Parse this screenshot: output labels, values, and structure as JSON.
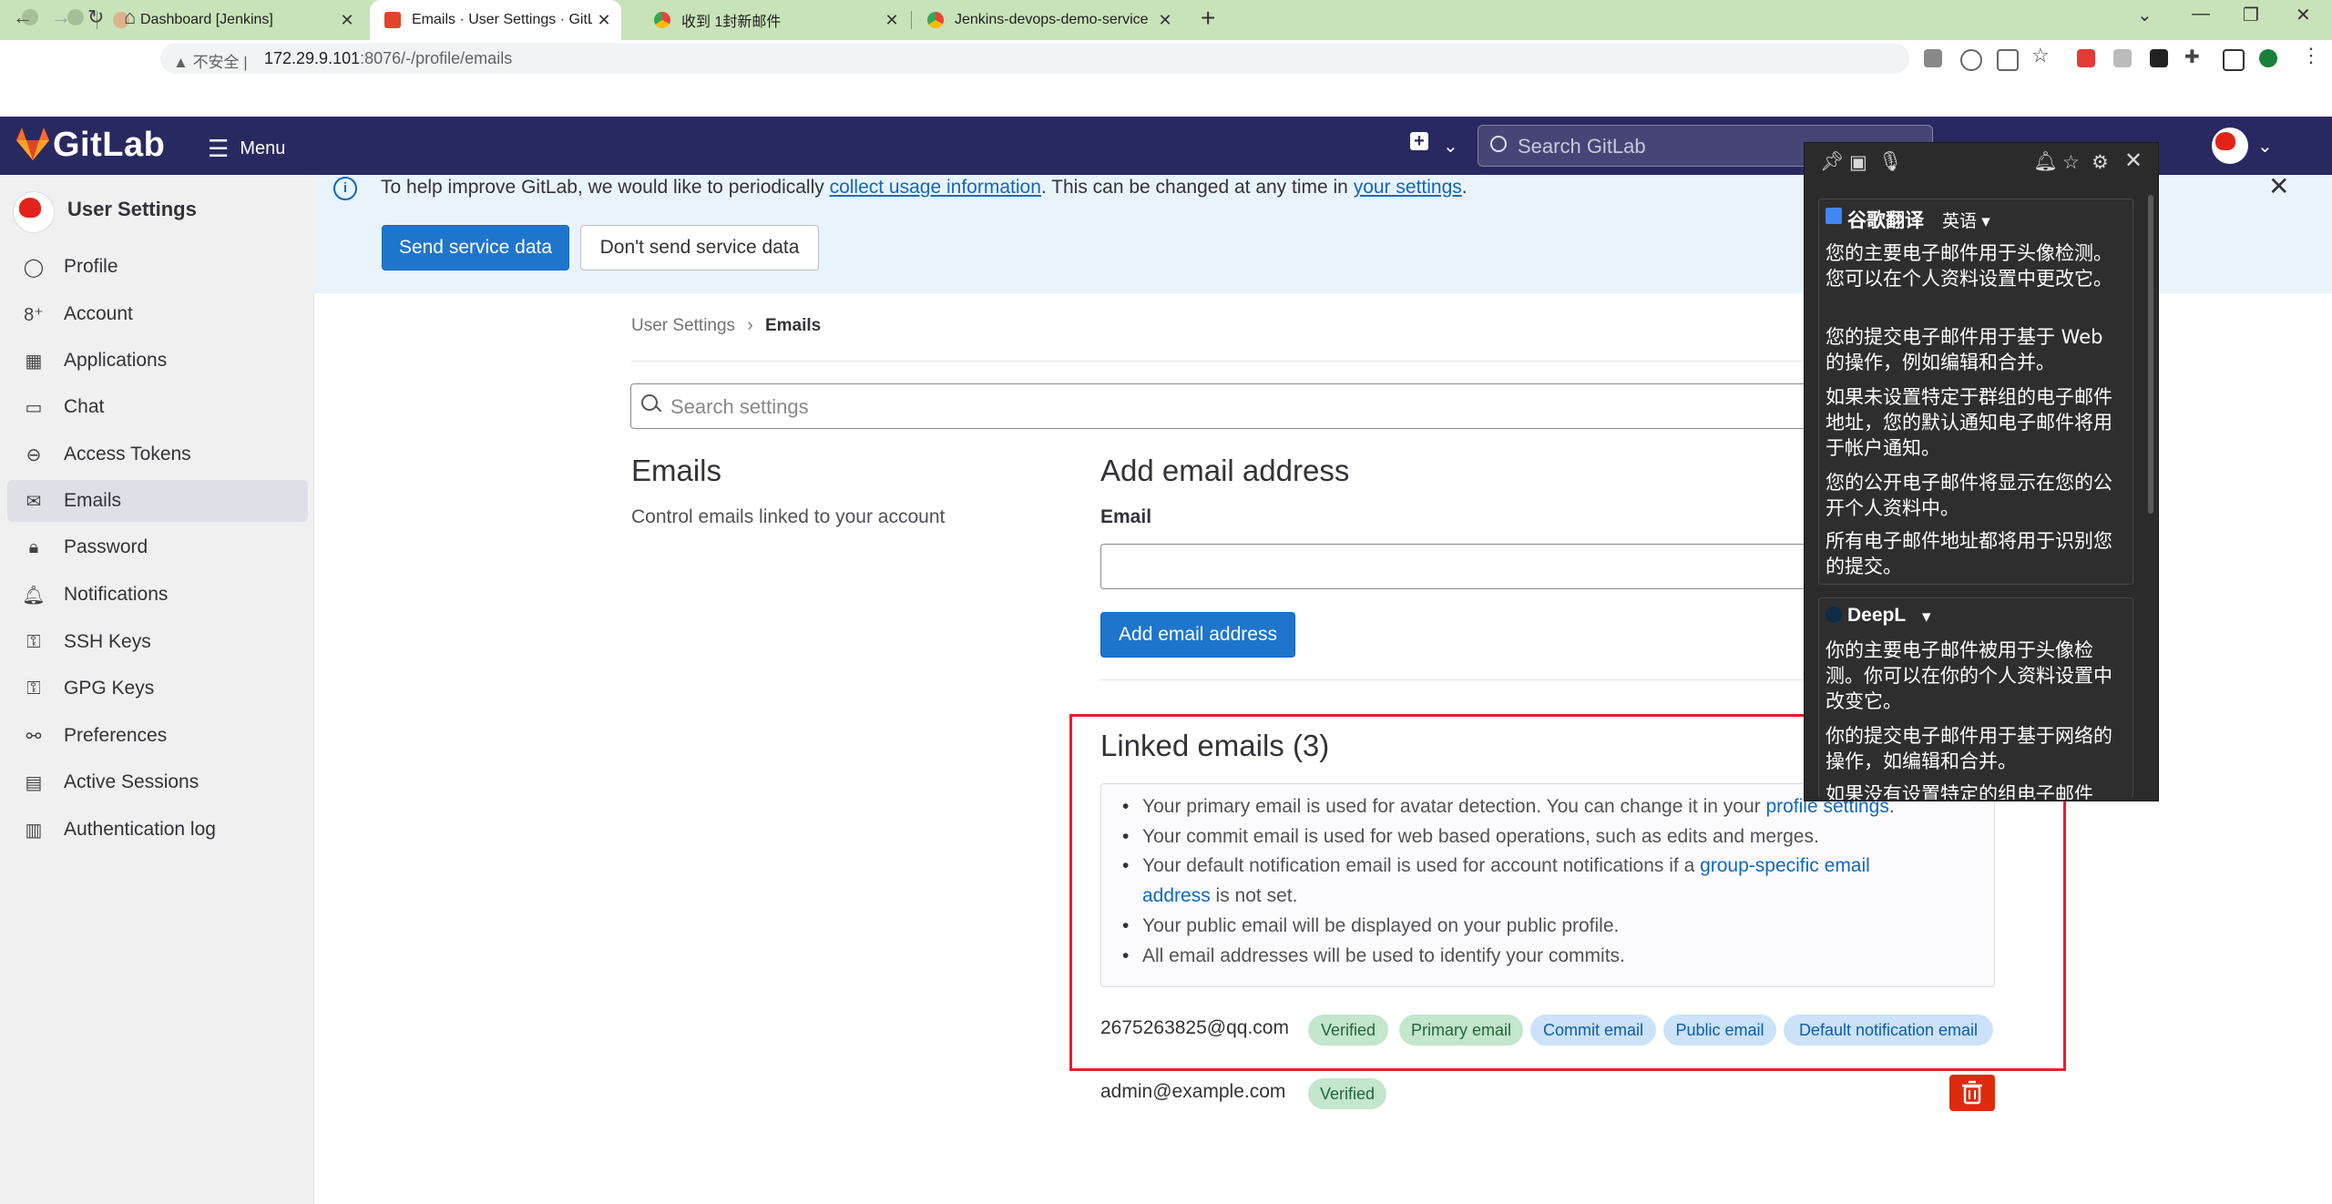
{
  "browser": {
    "tabs": [
      {
        "title": "Dashboard [Jenkins]"
      },
      {
        "title": "Emails · User Settings · GitLab"
      },
      {
        "title": "收到 1封新邮件"
      },
      {
        "title": "Jenkins-devops-demo-service"
      }
    ],
    "security_label": "不安全",
    "url_host": "172.29.9.101",
    "url_path": ":8076/-/profile/emails"
  },
  "header": {
    "brand": "GitLab",
    "menu_label": "Menu",
    "search_placeholder": "Search GitLab"
  },
  "sidebar": {
    "title": "User Settings",
    "items": [
      {
        "label": "Profile",
        "icon": "user-icon"
      },
      {
        "label": "Account",
        "icon": "account-icon"
      },
      {
        "label": "Applications",
        "icon": "applications-icon"
      },
      {
        "label": "Chat",
        "icon": "chat-icon"
      },
      {
        "label": "Access Tokens",
        "icon": "token-icon"
      },
      {
        "label": "Emails",
        "icon": "mail-icon"
      },
      {
        "label": "Password",
        "icon": "lock-icon"
      },
      {
        "label": "Notifications",
        "icon": "bell-icon"
      },
      {
        "label": "SSH Keys",
        "icon": "key-icon"
      },
      {
        "label": "GPG Keys",
        "icon": "key-icon"
      },
      {
        "label": "Preferences",
        "icon": "preferences-icon"
      },
      {
        "label": "Active Sessions",
        "icon": "monitor-icon"
      },
      {
        "label": "Authentication log",
        "icon": "log-icon"
      }
    ]
  },
  "banner": {
    "text_before": "To help improve GitLab, we would like to periodically ",
    "link1": "collect usage information",
    "text_middle": ". This can be changed at any time in ",
    "link2": "your settings",
    "text_after": ".",
    "send_button": "Send service data",
    "dont_send_button": "Don't send service data"
  },
  "breadcrumb": {
    "parent": "User Settings",
    "separator": "›",
    "current": "Emails"
  },
  "settings_search_placeholder": "Search settings",
  "emails_section": {
    "title": "Emails",
    "description": "Control emails linked to your account"
  },
  "add_email": {
    "title": "Add email address",
    "email_label": "Email",
    "email_value": "",
    "button": "Add email address"
  },
  "linked": {
    "title": "Linked emails (3)",
    "b1_text": "Your primary email is used for avatar detection. You can change it in your ",
    "b1_link": "profile settings",
    "b1_end": ".",
    "b2_text": "Your commit email is used for web based operations, such as edits and merges.",
    "b3_text": "Your default notification email is used for account notifications if a ",
    "b3_link": "group-specific email",
    "b3_link2": "address",
    "b3_end": " is not set.",
    "b4_text": "Your public email will be displayed on your public profile.",
    "b5_text": "All email addresses will be used to identify your commits.",
    "emails": [
      {
        "address": "2675263825@qq.com",
        "badges": [
          "Verified",
          "Primary email",
          "Commit email",
          "Public email",
          "Default notification email"
        ]
      },
      {
        "address": "admin@example.com",
        "badges": [
          "Verified"
        ]
      }
    ]
  },
  "translator": {
    "google": {
      "name": "谷歌翻译",
      "lang": "英语",
      "lines": [
        "您的主要电子邮件用于头像检测。",
        "您可以在个人资料设置中更改它。",
        "您的提交电子邮件用于基于 Web",
        "的操作，例如编辑和合并。",
        "如果未设置特定于群组的电子邮件",
        "地址，您的默认通知电子邮件将用",
        "于帐户通知。",
        "您的公开电子邮件将显示在您的公",
        "开个人资料中。",
        "所有电子邮件地址都将用于识别您",
        "的提交。"
      ]
    },
    "deepl": {
      "name": "DeepL",
      "lines": [
        "你的主要电子邮件被用于头像检",
        "测。你可以在你的个人资料设置中",
        "改变它。",
        "你的提交电子邮件用于基于网络的",
        "操作，如编辑和合并。",
        "如果没有设置特定的组电子邮件"
      ]
    }
  },
  "colors": {
    "header": "#292961",
    "primary": "#1f75cb",
    "danger": "#dd2b0e",
    "highlight": "#e61e2d"
  }
}
